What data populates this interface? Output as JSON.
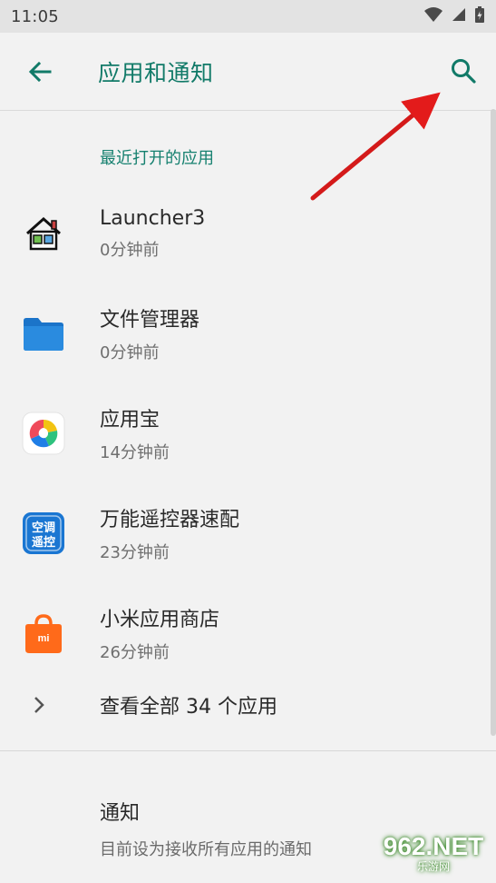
{
  "status_bar": {
    "time": "11:05",
    "icons": [
      "wifi-icon",
      "signal-icon",
      "battery-icon"
    ]
  },
  "appbar": {
    "title": "应用和通知",
    "accent_color": "#117a68"
  },
  "recent": {
    "header": "最近打开的应用",
    "apps": [
      {
        "name": "Launcher3",
        "time": "0分钟前",
        "icon": "launcher3-house-icon"
      },
      {
        "name": "文件管理器",
        "time": "0分钟前",
        "icon": "folder-icon"
      },
      {
        "name": "应用宝",
        "time": "14分钟前",
        "icon": "appstore-icon"
      },
      {
        "name": "万能遥控器速配",
        "time": "23分钟前",
        "icon": "remote-icon"
      },
      {
        "name": "小米应用商店",
        "time": "26分钟前",
        "icon": "mi-store-icon"
      }
    ],
    "see_all_label": "查看全部 34 个应用"
  },
  "remote_icon_text": {
    "line1": "空调",
    "line2": "遥控"
  },
  "mi_icon_text": "mi",
  "notifications": {
    "title": "通知",
    "subtitle": "目前设为接收所有应用的通知"
  },
  "watermark": {
    "top": "962.NET",
    "bottom": "乐游网"
  }
}
